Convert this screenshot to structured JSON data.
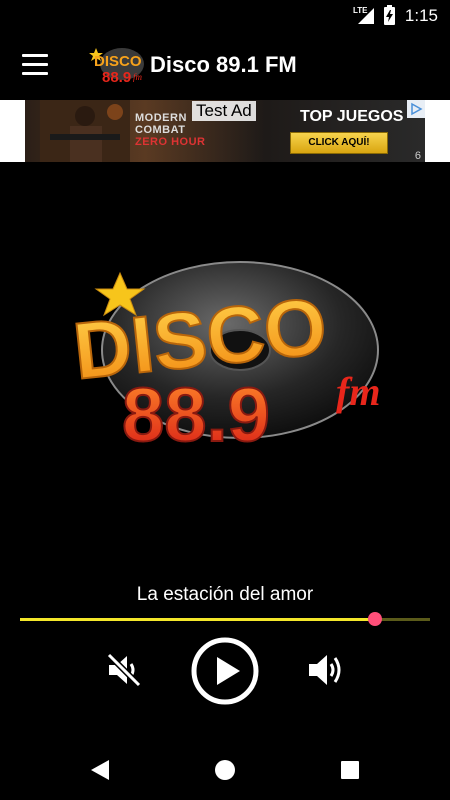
{
  "status_bar": {
    "time": "1:15",
    "network": "LTE",
    "icons": [
      "signal-icon",
      "battery-charging-icon"
    ]
  },
  "app_bar": {
    "title": "Disco 89.1 FM",
    "menu_icon": "menu-icon",
    "logo_text": [
      "DISCO",
      "88.9",
      "fm"
    ]
  },
  "ad": {
    "label": "Test Ad",
    "game_lines": [
      "MODERN",
      "COMBAT",
      "ZERO HOUR"
    ],
    "headline": "TOP JUEGOS",
    "cta": "CLICK AQUÍ!",
    "corner_number": "6",
    "choices_icon": "adchoices-icon"
  },
  "station": {
    "logo_text": [
      "DISCO",
      "88.9",
      "fm"
    ],
    "slogan": "La estación del amor"
  },
  "player": {
    "volume_level": 0.865,
    "mute_icon": "volume-mute-icon",
    "play_icon": "play-icon",
    "volume_icon": "volume-up-icon"
  },
  "nav_bar": {
    "icons": [
      "back-icon",
      "home-icon",
      "recents-icon"
    ]
  },
  "colors": {
    "accent_yellow": "#f4e72a",
    "thumb_pink": "#ff4f79",
    "logo_orange": "#f7a21b",
    "logo_red": "#e8261b"
  }
}
